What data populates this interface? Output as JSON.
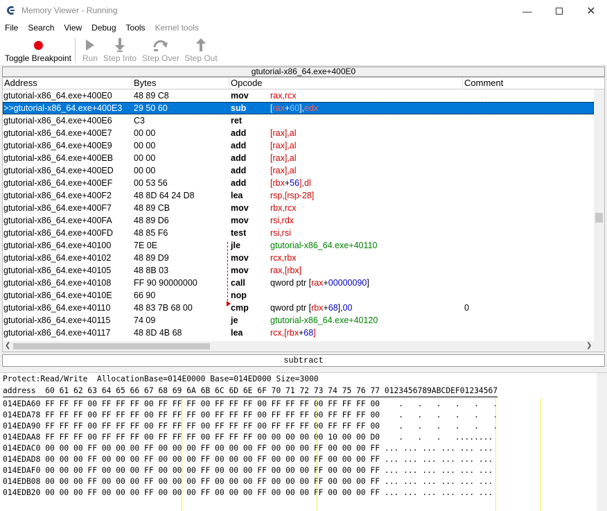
{
  "window": {
    "title": "Memory Viewer - Running",
    "icons": [
      "cheat-engine-icon",
      "minimize-icon",
      "maximize-icon",
      "close-icon"
    ]
  },
  "menu": [
    "File",
    "Search",
    "View",
    "Debug",
    "Tools",
    "Kernel tools"
  ],
  "toolbar": {
    "toggle_breakpoint": "Toggle Breakpoint",
    "run": "Run",
    "step_into": "Step Into",
    "step_over": "Step Over",
    "step_out": "Step Out"
  },
  "address_bar": "gtutorial-x86_64.exe+400E0",
  "columns": [
    "Address",
    "Bytes",
    "Opcode",
    "Comment"
  ],
  "rows": [
    {
      "addr": "gtutorial-x86_64.exe+400E0",
      "bytes": "48 89 C8",
      "op": "mov",
      "args": [
        [
          "reg",
          "rax,rcx"
        ]
      ],
      "comment": ""
    },
    {
      "addr": ">>gtutorial-x86_64.exe+400E3",
      "bytes": "29 50 60",
      "op": "sub",
      "args": [
        [
          "txt",
          "["
        ],
        [
          "reg",
          "rax"
        ],
        [
          "txt",
          "+"
        ],
        [
          "hx",
          "60"
        ],
        [
          "txt",
          "],"
        ],
        [
          "reg",
          "edx"
        ]
      ],
      "comment": "",
      "selected": true
    },
    {
      "addr": "gtutorial-x86_64.exe+400E6",
      "bytes": "C3",
      "op": "ret",
      "args": [],
      "comment": ""
    },
    {
      "addr": "gtutorial-x86_64.exe+400E7",
      "bytes": "00 00",
      "op": "add",
      "args": [
        [
          "reg",
          "[rax],al"
        ]
      ],
      "comment": ""
    },
    {
      "addr": "gtutorial-x86_64.exe+400E9",
      "bytes": "00 00",
      "op": "add",
      "args": [
        [
          "reg",
          "[rax],al"
        ]
      ],
      "comment": ""
    },
    {
      "addr": "gtutorial-x86_64.exe+400EB",
      "bytes": "00 00",
      "op": "add",
      "args": [
        [
          "reg",
          "[rax],al"
        ]
      ],
      "comment": ""
    },
    {
      "addr": "gtutorial-x86_64.exe+400ED",
      "bytes": "00 00",
      "op": "add",
      "args": [
        [
          "reg",
          "[rax],al"
        ]
      ],
      "comment": ""
    },
    {
      "addr": "gtutorial-x86_64.exe+400EF",
      "bytes": "00 53 56",
      "op": "add",
      "args": [
        [
          "reg",
          "[rbx"
        ],
        [
          "txt",
          "+"
        ],
        [
          "hx",
          "56"
        ],
        [
          "reg",
          "],dl"
        ]
      ],
      "comment": ""
    },
    {
      "addr": "gtutorial-x86_64.exe+400F2",
      "bytes": "48 8D 64 24 D8",
      "op": "lea",
      "args": [
        [
          "reg",
          "rsp,[rsp-28]"
        ]
      ],
      "comment": ""
    },
    {
      "addr": "gtutorial-x86_64.exe+400F7",
      "bytes": "48 89 CB",
      "op": "mov",
      "args": [
        [
          "reg",
          "rbx,rcx"
        ]
      ],
      "comment": ""
    },
    {
      "addr": "gtutorial-x86_64.exe+400FA",
      "bytes": "48 89 D6",
      "op": "mov",
      "args": [
        [
          "reg",
          "rsi,rdx"
        ]
      ],
      "comment": ""
    },
    {
      "addr": "gtutorial-x86_64.exe+400FD",
      "bytes": "48 85 F6",
      "op": "test",
      "args": [
        [
          "reg",
          "rsi,rsi"
        ]
      ],
      "comment": ""
    },
    {
      "addr": "gtutorial-x86_64.exe+40100",
      "bytes": "7E 0E",
      "op": "jle",
      "args": [
        [
          "sym",
          "gtutorial-x86_64.exe+40110"
        ]
      ],
      "comment": ""
    },
    {
      "addr": "gtutorial-x86_64.exe+40102",
      "bytes": "48 89 D9",
      "op": "mov",
      "args": [
        [
          "reg",
          "rcx,rbx"
        ]
      ],
      "comment": ""
    },
    {
      "addr": "gtutorial-x86_64.exe+40105",
      "bytes": "48 8B 03",
      "op": "mov",
      "args": [
        [
          "reg",
          "rax,[rbx]"
        ]
      ],
      "comment": ""
    },
    {
      "addr": "gtutorial-x86_64.exe+40108",
      "bytes": "FF 90 90000000",
      "op": "call",
      "args": [
        [
          "txt",
          "qword ptr ["
        ],
        [
          "reg",
          "rax"
        ],
        [
          "txt",
          "+"
        ],
        [
          "hx",
          "00000090"
        ],
        [
          "txt",
          "]"
        ]
      ],
      "comment": ""
    },
    {
      "addr": "gtutorial-x86_64.exe+4010E",
      "bytes": "66 90",
      "op": "nop",
      "args": [],
      "comment": ""
    },
    {
      "addr": "gtutorial-x86_64.exe+40110",
      "bytes": "48 83 7B 68 00",
      "op": "cmp",
      "args": [
        [
          "txt",
          "qword ptr ["
        ],
        [
          "reg",
          "rbx"
        ],
        [
          "txt",
          "+"
        ],
        [
          "hx",
          "68"
        ],
        [
          "txt",
          "],"
        ],
        [
          "hx",
          "00"
        ]
      ],
      "comment": "0"
    },
    {
      "addr": "gtutorial-x86_64.exe+40115",
      "bytes": "74 09",
      "op": "je",
      "args": [
        [
          "sym",
          "gtutorial-x86_64.exe+40120"
        ]
      ],
      "comment": ""
    },
    {
      "addr": "gtutorial-x86_64.exe+40117",
      "bytes": "48 8D 4B 68",
      "op": "lea",
      "args": [
        [
          "reg",
          "rcx,[rbx"
        ],
        [
          "txt",
          "+"
        ],
        [
          "hx",
          "68"
        ],
        [
          "reg",
          "]"
        ]
      ],
      "comment": ""
    }
  ],
  "opcode_description": "subtract",
  "hex_view": {
    "info": "Protect:Read/Write  AllocationBase=014E0000 Base=014ED000 Size=3000",
    "header": "address  60 61 62 63 64 65 66 67 68 69 6A 6B 6C 6D 6E 6F 70 71 72 73 74 75 76 77 0123456789ABCDEF01234567",
    "lines": [
      "014EDA60 FF FF FF 00 FF FF FF 00 FF FF FF 00 FF FF FF 00 FF FF FF 00 FF FF FF 00    .   .   .   .   .   .",
      "014EDA78 FF FF FF 00 FF FF FF 00 FF FF FF 00 FF FF FF 00 FF FF FF 00 FF FF FF 00    .   .   .   .   .   .",
      "014EDA90 FF FF FF 00 FF FF FF 00 FF FF FF 00 FF FF FF 00 FF FF FF 00 FF FF FF 00    .   .   .   .   .   .",
      "014EDAA8 FF FF FF 00 FF FF FF 00 FF FF FF 00 FF FF FF 00 00 00 00 00 10 00 00 D0    .   .   .   ........",
      "014EDAC0 00 00 00 FF 00 00 00 FF 00 00 00 FF 00 00 00 FF 00 00 00 FF 00 00 00 FF ... ... ... ... ... ...",
      "014EDAD8 00 00 00 FF 00 00 00 FF 00 00 00 FF 00 00 00 FF 00 00 00 FF 00 00 00 FF ... ... ... ... ... ...",
      "014EDAF0 00 00 00 FF 00 00 00 FF 00 00 00 FF 00 00 00 FF 00 00 00 FF 00 00 00 FF ... ... ... ... ... ...",
      "014EDB08 00 00 00 FF 00 00 00 FF 00 00 00 FF 00 00 00 FF 00 00 00 FF 00 00 00 FF ... ... ... ... ... ...",
      "014EDB20 00 00 00 FF 00 00 00 FF 00 00 00 FF 00 00 00 FF 00 00 00 FF 00 00 00 FF ... ... ... ... ... ..."
    ]
  },
  "colors": {
    "selection": "#0078d7",
    "register": "#d00000",
    "symbol": "#008000",
    "hex": "#0000c0",
    "breakpoint": "#e0000e"
  }
}
